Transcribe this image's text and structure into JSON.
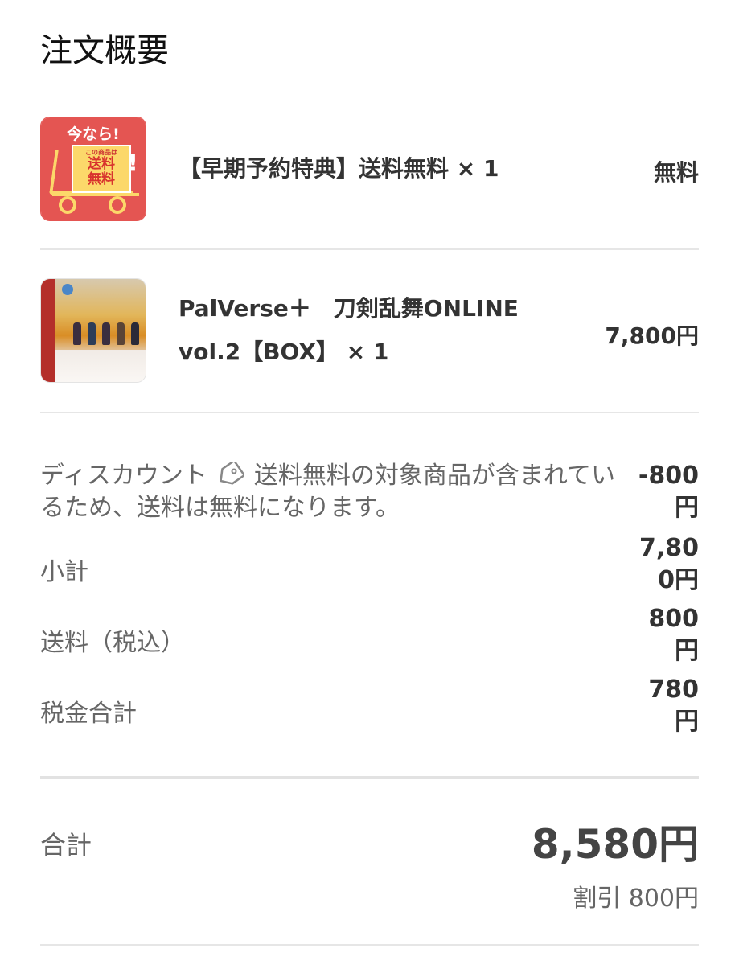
{
  "page_title": "注文概要",
  "items": [
    {
      "name": "【早期予約特典】送料無料 × 1",
      "price": "無料",
      "thumb_text": {
        "top": "今なら!",
        "small": "この商品は",
        "big": "送料無料",
        "bang": "!"
      }
    },
    {
      "name": "PalVerse＋　刀剣乱舞ONLINE vol.2【BOX】 × 1",
      "price": "7,800円"
    }
  ],
  "summary": {
    "discount_label": "ディスカウント",
    "discount_note": "送料無料の対象商品が含まれているため、送料は無料になります。",
    "discount_value": "-800円",
    "subtotal_label": "小計",
    "subtotal_value": "7,800円",
    "shipping_label": "送料（税込）",
    "shipping_value": "800円",
    "tax_label": "税金合計",
    "tax_value": "780円"
  },
  "total": {
    "label": "合計",
    "value": "8,580円",
    "discount_note": "割引 800円"
  },
  "colors": {
    "badge_red": "#e45552",
    "badge_yellow": "#fcd86a",
    "text_dark": "#333333",
    "text_muted": "#666666"
  }
}
